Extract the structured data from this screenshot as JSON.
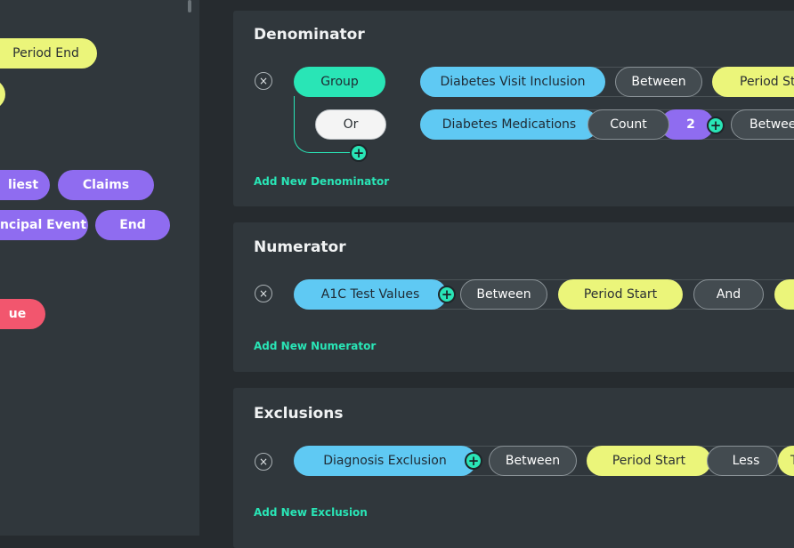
{
  "sidebar": {
    "period_end": "Period End",
    "earliest": "liest",
    "claims": "Claims",
    "principal_event": "ncipal Event",
    "end": "End",
    "value": "ue"
  },
  "denominator": {
    "title": "Denominator",
    "group_label": "Group",
    "or_label": "Or",
    "row1": {
      "criteria": "Diabetes Visit Inclusion",
      "op": "Between",
      "value": "Period St"
    },
    "row2": {
      "criteria": "Diabetes Medications",
      "op": "Count",
      "count": "2",
      "op2": "Betwee"
    },
    "add_link": "Add New Denominator"
  },
  "numerator": {
    "title": "Numerator",
    "row": {
      "criteria": "A1C Test Values",
      "op": "Between",
      "value": "Period Start",
      "and": "And"
    },
    "add_link": "Add New Numerator"
  },
  "exclusions": {
    "title": "Exclusions",
    "row": {
      "criteria": "Diagnosis Exclusion",
      "op": "Between",
      "value": "Period Start",
      "less": "Less",
      "trail": "T"
    },
    "add_link": "Add New Exclusion"
  },
  "icons": {
    "remove": "×",
    "add": "+"
  },
  "colors": {
    "criteria": "#5fc9f3",
    "operator": "#434b50",
    "period": "#ebf57a",
    "event": "#8f6cf0",
    "value": "#f2566e",
    "accent": "#29e5b6"
  }
}
